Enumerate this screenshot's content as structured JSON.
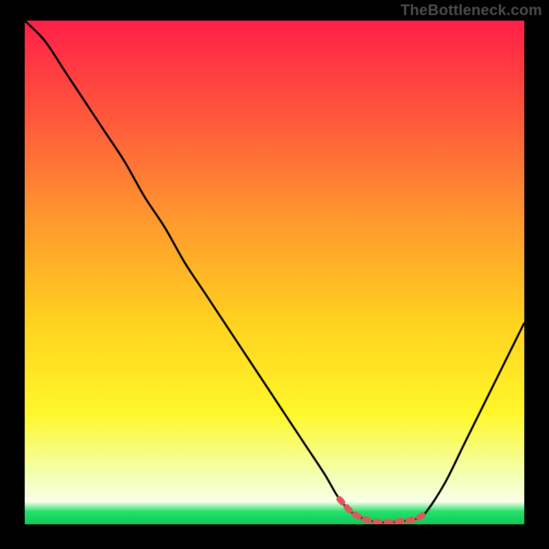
{
  "watermark": "TheBottleneck.com",
  "chart_data": {
    "type": "line",
    "title": "",
    "xlabel": "",
    "ylabel": "",
    "xlim": [
      0,
      100
    ],
    "ylim": [
      0,
      100
    ],
    "grid": false,
    "series": [
      {
        "name": "curve",
        "x": [
          0,
          4,
          8,
          12,
          16,
          20,
          24,
          28,
          32,
          36,
          40,
          44,
          48,
          52,
          56,
          60,
          63,
          66,
          70,
          74,
          78,
          80,
          84,
          88,
          92,
          96,
          100
        ],
        "y": [
          100,
          96,
          90,
          84,
          78,
          72,
          65,
          59,
          52,
          46,
          40,
          34,
          28,
          22,
          16,
          10,
          5,
          2,
          0.5,
          0.5,
          1,
          2,
          8,
          16,
          24,
          32,
          40
        ]
      },
      {
        "name": "highlight",
        "x": [
          63,
          66,
          70,
          74,
          78,
          80
        ],
        "y": [
          5,
          2,
          0.5,
          0.5,
          1,
          2
        ]
      }
    ],
    "gradient_stops": [
      {
        "offset": 0.0,
        "color": "#ff1f47"
      },
      {
        "offset": 0.2,
        "color": "#ff5a3c"
      },
      {
        "offset": 0.4,
        "color": "#ff9a2e"
      },
      {
        "offset": 0.6,
        "color": "#ffd21f"
      },
      {
        "offset": 0.78,
        "color": "#fff72a"
      },
      {
        "offset": 0.9,
        "color": "#f4ffb0"
      },
      {
        "offset": 0.955,
        "color": "#f8ffe8"
      },
      {
        "offset": 0.975,
        "color": "#23e06a"
      },
      {
        "offset": 1.0,
        "color": "#0fc95a"
      }
    ],
    "highlight_color": "#d85a5a",
    "curve_color": "#000000"
  }
}
